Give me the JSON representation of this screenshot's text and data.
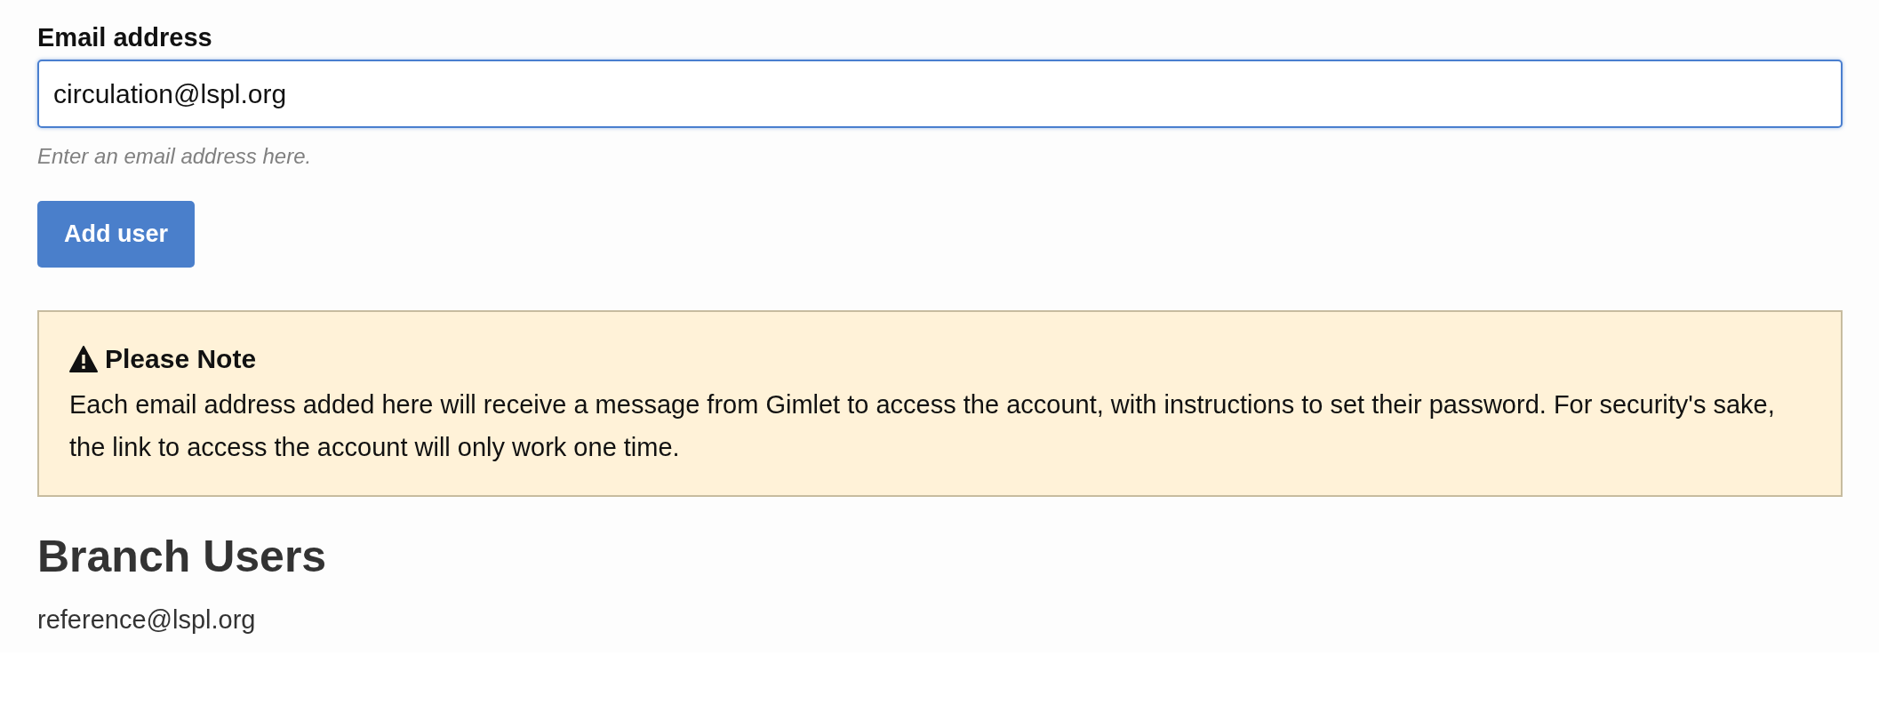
{
  "email_field": {
    "label": "Email address",
    "value": "circulation@lspl.org",
    "focused": true,
    "hint": "Enter an email address here."
  },
  "add_button": {
    "label": "Add user"
  },
  "note": {
    "title": "Please Note",
    "text": "Each email address added here will receive a message from Gimlet to access the account, with instructions to set their password. For security's sake, the link to access the account will only work one time."
  },
  "branch_users": {
    "heading": "Branch Users",
    "users": [
      "reference@lspl.org"
    ]
  }
}
